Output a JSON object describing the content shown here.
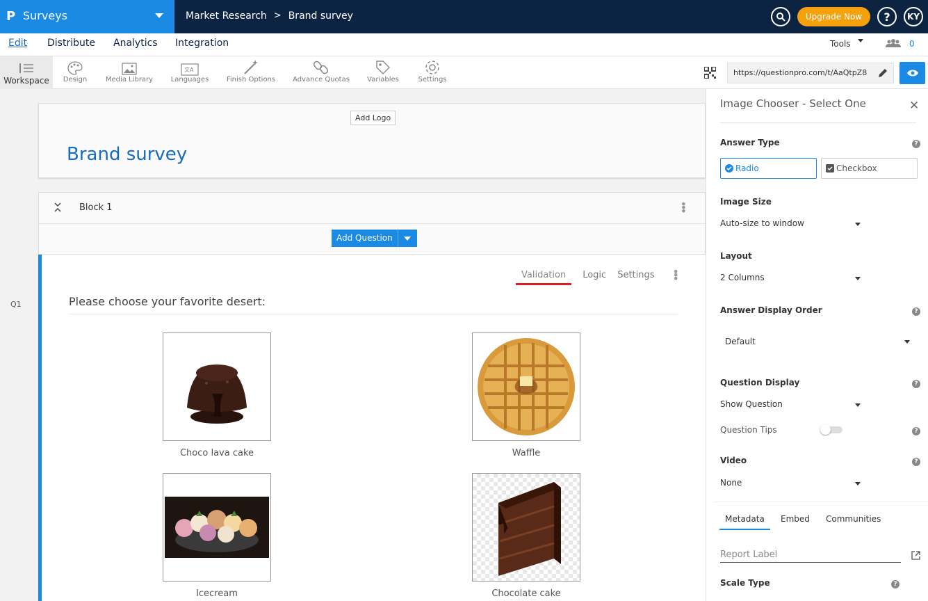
{
  "app": {
    "logo": "P",
    "name": "Surveys"
  },
  "breadcrumb": {
    "parent": "Market Research",
    "separator": ">",
    "current": "Brand survey"
  },
  "header": {
    "upgrade_label": "Upgrade Now",
    "help_label": "?",
    "avatar_initials": "KY"
  },
  "nav_tabs": {
    "edit": "Edit",
    "distribute": "Distribute",
    "analytics": "Analytics",
    "integration": "Integration",
    "tools": "Tools",
    "user_count": "0"
  },
  "toolbar": {
    "workspace": "Workspace",
    "design": "Design",
    "media_library": "Media Library",
    "languages": "Languages",
    "finish_options": "Finish Options",
    "advance_quotas": "Advance Quotas",
    "variables": "Variables",
    "settings": "Settings",
    "survey_url": "https://questionpro.com/t/AaQtpZ8"
  },
  "survey": {
    "add_logo": "Add Logo",
    "title": "Brand survey",
    "block_label": "Block 1",
    "add_question": "Add Question"
  },
  "question": {
    "number": "Q1",
    "tabs": {
      "validation": "Validation",
      "logic": "Logic",
      "settings": "Settings"
    },
    "text": "Please choose your favorite desert:",
    "options": [
      {
        "label": "Choco lava cake"
      },
      {
        "label": "Waffle"
      },
      {
        "label": "Icecream"
      },
      {
        "label": "Chocolate cake"
      }
    ]
  },
  "panel": {
    "title": "Image Chooser - Select One",
    "answer_type_label": "Answer Type",
    "radio_label": "Radio",
    "checkbox_label": "Checkbox",
    "image_size_label": "Image Size",
    "image_size_value": "Auto-size to window",
    "layout_label": "Layout",
    "layout_value": "2 Columns",
    "display_order_label": "Answer Display Order",
    "display_order_value": "Default",
    "question_display_label": "Question Display",
    "question_display_value": "Show Question",
    "question_tips_label": "Question Tips",
    "video_label": "Video",
    "video_value": "None",
    "tabs": {
      "metadata": "Metadata",
      "embed": "Embed",
      "communities": "Communities"
    },
    "report_label_placeholder": "Report Label",
    "scale_type_label": "Scale Type"
  },
  "colors": {
    "brand_blue": "#1a8ae4",
    "navy": "#0c2442",
    "upgrade_orange": "#f5a10e",
    "validation_underline": "#e02020"
  }
}
